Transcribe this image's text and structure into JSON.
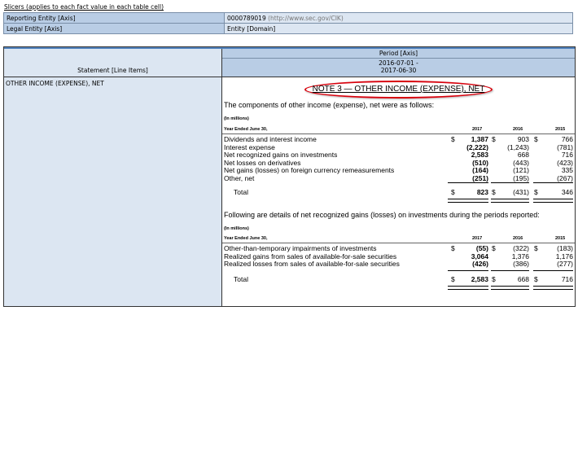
{
  "slicers": {
    "title": "Slicers (applies to each fact value in each table cell)",
    "rows": [
      {
        "label": "Reporting Entity [Axis]",
        "value": "0000789019",
        "extra": "(http://www.sec.gov/CIK)"
      },
      {
        "label": "Legal Entity [Axis]",
        "value": "Entity [Domain]",
        "extra": ""
      }
    ]
  },
  "statement": {
    "header": "Statement [Line Items]",
    "period_axis": "Period [Axis]",
    "period_start": "2016-07-01 -",
    "period_end": "2017-06-30",
    "row_label": "OTHER INCOME (EXPENSE), NET"
  },
  "note": {
    "title": "NOTE 3 — OTHER INCOME (EXPENSE), NET",
    "intro1": "The components of other income (expense), net were as follows:",
    "intro2": "Following are details of net recognized gains (losses) on investments during the periods reported:",
    "unit": "(In millions)",
    "period_label": "Year Ended June 30,",
    "years": [
      "2017",
      "2016",
      "2015"
    ],
    "table1": [
      {
        "label": "Dividends and interest income",
        "d17": "$",
        "v17": "1,387",
        "d16": "$",
        "v16": "903",
        "d15": "$",
        "v15": "766"
      },
      {
        "label": "Interest expense",
        "d17": "",
        "v17": "(2,222)",
        "d16": "",
        "v16": "(1,243)",
        "d15": "",
        "v15": "(781)"
      },
      {
        "label": "Net recognized gains on investments",
        "d17": "",
        "v17": "2,583",
        "d16": "",
        "v16": "668",
        "d15": "",
        "v15": "716"
      },
      {
        "label": "Net losses on derivatives",
        "d17": "",
        "v17": "(510)",
        "d16": "",
        "v16": "(443)",
        "d15": "",
        "v15": "(423)"
      },
      {
        "label": "Net gains (losses) on foreign currency remeasurements",
        "d17": "",
        "v17": "(164)",
        "d16": "",
        "v16": "(121)",
        "d15": "",
        "v15": "335"
      },
      {
        "label": "Other, net",
        "d17": "",
        "v17": "(251)",
        "d16": "",
        "v16": "(195)",
        "d15": "",
        "v15": "(267)"
      }
    ],
    "table1_total": {
      "label": "Total",
      "d17": "$",
      "v17": "823",
      "d16": "$",
      "v16": "(431)",
      "d15": "$",
      "v15": "346"
    },
    "table2": [
      {
        "label": "Other-than-temporary impairments of investments",
        "d17": "$",
        "v17": "(55)",
        "d16": "$",
        "v16": "(322)",
        "d15": "$",
        "v15": "(183)"
      },
      {
        "label": "Realized gains from sales of available-for-sale securities",
        "d17": "",
        "v17": "3,064",
        "d16": "",
        "v16": "1,376",
        "d15": "",
        "v15": "1,176"
      },
      {
        "label": "Realized losses from sales of available-for-sale securities",
        "d17": "",
        "v17": "(426)",
        "d16": "",
        "v16": "(386)",
        "d15": "",
        "v15": "(277)"
      }
    ],
    "table2_total": {
      "label": "Total",
      "d17": "$",
      "v17": "2,583",
      "d16": "$",
      "v16": "668",
      "d15": "$",
      "v15": "716"
    }
  }
}
